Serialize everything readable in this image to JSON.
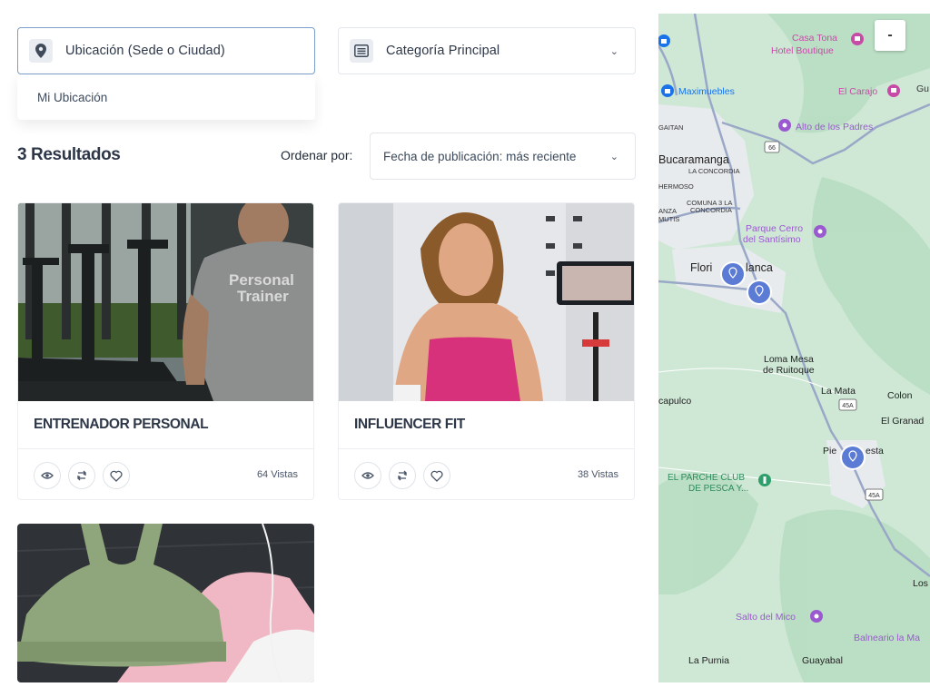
{
  "filters": {
    "location": {
      "label": "Ubicación (Sede o Ciudad)",
      "icon": "location-pin-icon"
    },
    "category": {
      "label": "Categoría Principal",
      "icon": "list-icon"
    },
    "location_dropdown": {
      "option": "Mi Ubicación"
    }
  },
  "results": {
    "count_label": "3 Resultados",
    "sort_label": "Ordenar por:",
    "sort_value": "Fecha de publicación: más reciente"
  },
  "cards": [
    {
      "title": "ENTRENADOR PERSONAL",
      "views": "64 Vistas",
      "shirt_text_1": "Personal",
      "shirt_text_2": "Trainer"
    },
    {
      "title": "INFLUENCER FIT",
      "views": "38 Vistas"
    },
    {
      "title": ""
    }
  ],
  "map": {
    "zoom_out": "-",
    "places": {
      "casa_tona": "Casa Tona",
      "hotel_boutique": "Hotel Boutique",
      "maximuebles": "Maximuebles",
      "el_carajo": "El Carajo",
      "gu": "Gu",
      "gaitan": "GAITAN",
      "alto_padres": "Alto de los Padres",
      "bucaramanga": "Bucaramanga",
      "la_concordia": "LA CONCORDIA",
      "hermoso": "HERMOSO",
      "comuna_la_concordia_1": "COMUNA 3 LA",
      "comuna_la_concordia_2": "CONCORDIA",
      "anza": "ANZA",
      "mutis": "MUTIS",
      "parque_cerro_1": "Parque Cerro",
      "parque_cerro_2": "del Santísimo",
      "floridablanca_1": "Flori",
      "floridablanca_2": "lanca",
      "loma_mesa_1": "Loma Mesa",
      "loma_mesa_2": "de Ruitoque",
      "acapulco": "capulco",
      "la_mata": "La Mata",
      "colon": "Colon",
      "el_granad": "El Granad",
      "piedecuesta_1": "Pie",
      "piedecuesta_2": "esta",
      "parche_1": "EL PARCHE CLUB",
      "parche_2": "DE PESCA Y...",
      "los": "Los",
      "salto_mico": "Salto del Mico",
      "balneario": "Balneario la Ma",
      "la_purnia": "La Purnia",
      "guayabal": "Guayabal",
      "road_66": "66",
      "road_45a_1": "45A",
      "road_45a_2": "45A"
    }
  },
  "colors": {
    "map_green": "#cfe8d6",
    "map_green_dark": "#b7ddc2",
    "urban": "#e8ebee",
    "road": "#9aa8c7",
    "pin": "#5b7bd5",
    "poi_pink": "#c74aa7",
    "poi_purple": "#9b59d0"
  }
}
